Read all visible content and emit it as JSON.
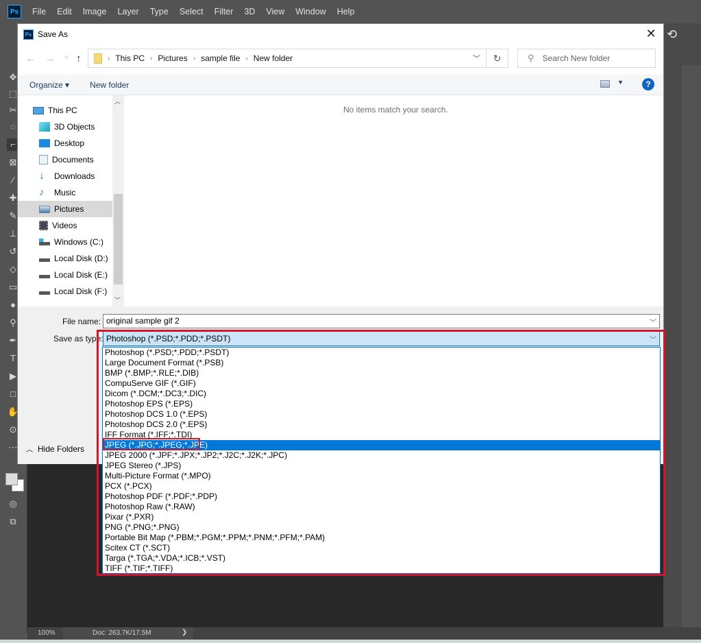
{
  "photoshop": {
    "logo": "Ps",
    "menu": [
      "File",
      "Edit",
      "Image",
      "Layer",
      "Type",
      "Select",
      "Filter",
      "3D",
      "View",
      "Window",
      "Help"
    ],
    "status": {
      "zoom": "100%",
      "doc": "Doc: 263.7K/17.5M",
      "arrow": "❯"
    }
  },
  "dialog": {
    "title": "Save As",
    "close": "✕",
    "nav": {
      "back": "←",
      "forward": "→",
      "recent": "˅",
      "up": "↑"
    },
    "breadcrumb": [
      "This PC",
      "Pictures",
      "sample file",
      "New folder"
    ],
    "refresh": "↻",
    "search_placeholder": "Search New folder",
    "toolbar": {
      "organize": "Organize ▾",
      "new_folder": "New folder",
      "help": "?"
    },
    "tree": [
      {
        "label": "This PC",
        "icon": "computer-icon"
      },
      {
        "label": "3D Objects",
        "icon": "cube-icon"
      },
      {
        "label": "Desktop",
        "icon": "desktop-icon"
      },
      {
        "label": "Documents",
        "icon": "document-icon"
      },
      {
        "label": "Downloads",
        "icon": "download-icon"
      },
      {
        "label": "Music",
        "icon": "music-icon"
      },
      {
        "label": "Pictures",
        "icon": "pictures-icon",
        "selected": true
      },
      {
        "label": "Videos",
        "icon": "video-icon"
      },
      {
        "label": "Windows (C:)",
        "icon": "drive-icon"
      },
      {
        "label": "Local Disk (D:)",
        "icon": "drive-icon"
      },
      {
        "label": "Local Disk (E:)",
        "icon": "drive-icon"
      },
      {
        "label": "Local Disk (F:)",
        "icon": "drive-icon"
      }
    ],
    "empty_message": "No items match your search.",
    "file_name_label": "File name:",
    "file_name_value": "original sample gif 2",
    "save_as_type_label": "Save as type:",
    "save_as_type_value": "Photoshop (*.PSD;*.PDD;*.PSDT)",
    "hide_folders": "Hide Folders",
    "file_types": [
      "Photoshop (*.PSD;*.PDD;*.PSDT)",
      "Large Document Format (*.PSB)",
      "BMP (*.BMP;*.RLE;*.DIB)",
      "CompuServe GIF (*.GIF)",
      "Dicom (*.DCM;*.DC3;*.DIC)",
      "Photoshop EPS (*.EPS)",
      "Photoshop DCS 1.0 (*.EPS)",
      "Photoshop DCS 2.0 (*.EPS)",
      "IFF Format (*.IFF;*.TDI)",
      "JPEG (*.JPG;*.JPEG;*.JPE)",
      "JPEG 2000 (*.JPF;*.JPX;*.JP2;*.J2C;*.J2K;*.JPC)",
      "JPEG Stereo (*.JPS)",
      "Multi-Picture Format (*.MPO)",
      "PCX (*.PCX)",
      "Photoshop PDF (*.PDF;*.PDP)",
      "Photoshop Raw (*.RAW)",
      "Pixar (*.PXR)",
      "PNG (*.PNG;*.PNG)",
      "Portable Bit Map (*.PBM;*.PGM;*.PPM;*.PNM;*.PFM;*.PAM)",
      "Scitex CT (*.SCT)",
      "Targa (*.TGA;*.VDA;*.ICB;*.VST)",
      "TIFF (*.TIF;*.TIFF)"
    ],
    "highlighted_type_index": 9
  },
  "colors": {
    "highlight": "#0078d7",
    "annotation": "#d9142a"
  }
}
